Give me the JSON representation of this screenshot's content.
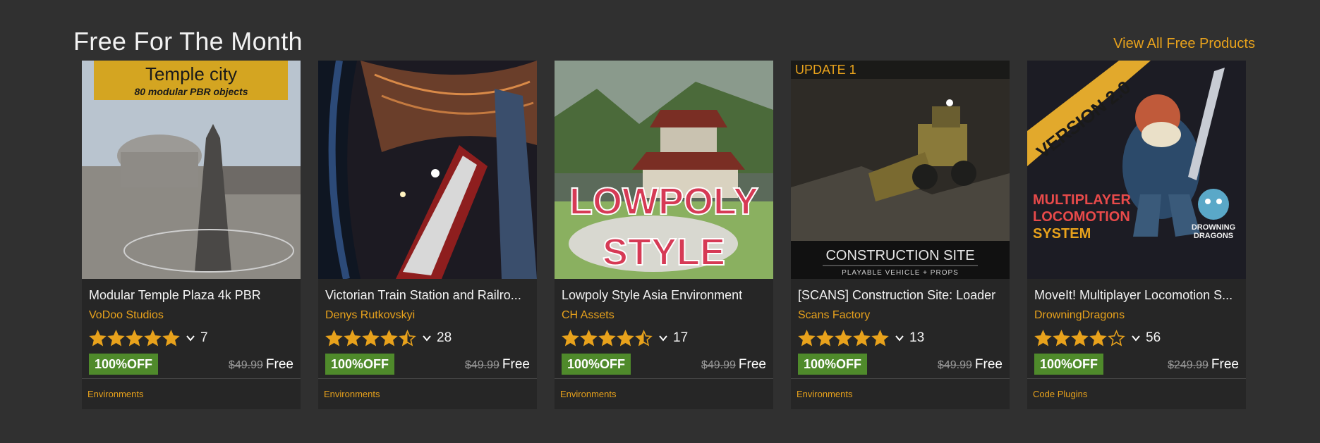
{
  "section": {
    "title": "Free For The Month",
    "view_all_label": "View All Free Products"
  },
  "colors": {
    "accent": "#e8a21c",
    "badge": "#4f8a2b",
    "background": "#303030",
    "card": "#262626"
  },
  "products": [
    {
      "title": "Modular Temple Plaza 4k PBR",
      "seller": "VoDoo Studios",
      "rating": 5,
      "rating_count": "7",
      "discount": "100%OFF",
      "old_price": "$49.99",
      "price": "Free",
      "category": "Environments",
      "thumb_text_1": "Temple city",
      "thumb_text_2": "80 modular PBR objects"
    },
    {
      "title": "Victorian Train Station and Railro...",
      "seller": "Denys Rutkovskyi",
      "rating": 4.5,
      "rating_count": "28",
      "discount": "100%OFF",
      "old_price": "$49.99",
      "price": "Free",
      "category": "Environments"
    },
    {
      "title": "Lowpoly Style Asia Environment",
      "seller": "CH Assets",
      "rating": 4.5,
      "rating_count": "17",
      "discount": "100%OFF",
      "old_price": "$49.99",
      "price": "Free",
      "category": "Environments",
      "thumb_text_1": "LOWPOLY",
      "thumb_text_2": "STYLE"
    },
    {
      "title": "[SCANS] Construction Site: Loader",
      "seller": "Scans Factory",
      "rating": 5,
      "rating_count": "13",
      "discount": "100%OFF",
      "old_price": "$49.99",
      "price": "Free",
      "category": "Environments",
      "thumb_text_1": "UPDATE 1",
      "thumb_text_2": "CONSTRUCTION SITE",
      "thumb_text_3": "PLAYABLE VEHICLE + PROPS"
    },
    {
      "title": "MoveIt! Multiplayer Locomotion S...",
      "seller": "DrowningDragons",
      "rating": 4,
      "rating_count": "56",
      "discount": "100%OFF",
      "old_price": "$249.99",
      "price": "Free",
      "category": "Code Plugins",
      "thumb_text_1": "VERSION 2.0",
      "thumb_text_2": "MULTIPLAYER",
      "thumb_text_3": "LOCOMOTION",
      "thumb_text_4": "SYSTEM",
      "thumb_text_5": "DROWNING",
      "thumb_text_6": "DRAGONS"
    }
  ]
}
